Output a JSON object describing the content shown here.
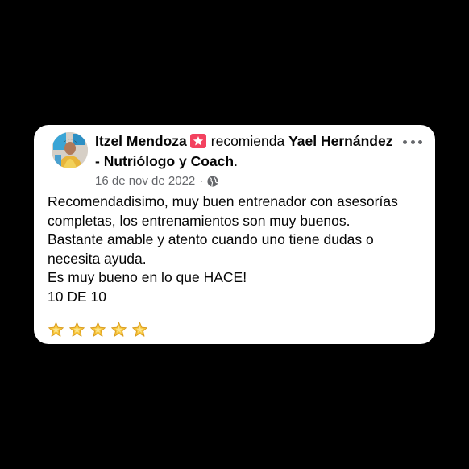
{
  "review": {
    "reviewer_name": "Itzel Mendoza",
    "verb": "recomienda",
    "page_name": "Yael Hernández - Nutriólogo y Coach",
    "trailing_punct": ".",
    "date": "16 de nov de 2022",
    "separator": "·",
    "privacy_icon": "globe-icon",
    "recommend_badge_icon": "recommend-star-icon",
    "more_icon": "more-options-icon",
    "lines": [
      "Recomendadisimo, muy buen entrenador con asesorías completas, los entrenamientos son muy buenos.",
      "Bastante amable y atento cuando uno tiene dudas o necesita ayuda.",
      "Es muy bueno en lo que HACE!",
      "10 DE 10"
    ],
    "rating": 5,
    "star_emoji_count": 5
  },
  "colors": {
    "background": "#000000",
    "card": "#ffffff",
    "text_primary": "#050505",
    "text_secondary": "#65676b",
    "recommend_badge": "#f3425f",
    "star": "#f5c33b"
  }
}
